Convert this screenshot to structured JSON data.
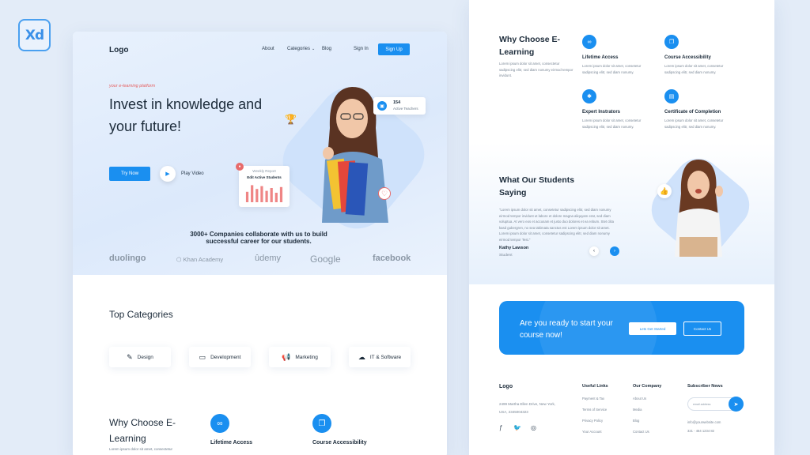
{
  "app": {
    "badge": "Xd"
  },
  "left": {
    "nav": {
      "logo": "Logo",
      "about": "About",
      "categories": "Categories",
      "blog": "Blog",
      "signin": "Sign In",
      "signup": "Sign Up"
    },
    "hero": {
      "tagline": "your e-learning platform",
      "title": "Invest in knowledge and your future!",
      "try_now": "Try Now",
      "play_video": "Play Video",
      "teachers_count": "154",
      "teachers_label": "Active Teachers",
      "report_title": "Weekly Report",
      "report_sub": "Edit Active Students",
      "report_bars": [
        0.55,
        0.9,
        0.7,
        0.85,
        0.6,
        0.75,
        0.5,
        0.8
      ],
      "companies_text": "3000+ Companies collaborate with us to build successful career for our students."
    },
    "brands": [
      "duolingo",
      "Khan Academy",
      "ûdemy",
      "Google",
      "facebook"
    ],
    "top_categories": {
      "title": "Top Categories",
      "items": [
        {
          "label": "Design",
          "icon": "design-icon"
        },
        {
          "label": "Development",
          "icon": "code-icon"
        },
        {
          "label": "Marketing",
          "icon": "megaphone-icon"
        },
        {
          "label": "IT & Software",
          "icon": "cloud-icon"
        }
      ]
    },
    "why": {
      "title": "Why Choose E-Learning",
      "text": "Lorem ipsum dolor sit amet, consectetur",
      "f1": "Lifetime Access",
      "f2": "Course Accessibility"
    }
  },
  "right": {
    "why": {
      "title": "Why Choose E-Learning",
      "desc": "Lorem ipsum dolor sit amet, consectetur sadipscing elitr, sed diam nonumy eirmod tempor invidunt.",
      "features": [
        {
          "title": "Lifetime Access",
          "text": "Lorem ipsum dolor sit amet, consetetur sadipscing elitr, sed diam nonumy."
        },
        {
          "title": "Course Accessibility",
          "text": "Lorem ipsum dolor sit amet, consetetur sadipscing elitr, sed diam nonumy."
        },
        {
          "title": "Expert Instrators",
          "text": "Lorem ipsum dolor sit amet, consetetur sadipscing elitr, sed diam nonumy."
        },
        {
          "title": "Certificate of Completion",
          "text": "Lorem ipsum dolor sit amet, consetetur sadipscing elitr, sed diam nonumy."
        }
      ]
    },
    "students": {
      "title": "What Our Students Saying",
      "quote": "\"Lorem ipsum dolor sit amet, consetetur sadipscing elitr, sed diam nonumy eirmod tempor invidunt ut labore et dolore magna aliquyam erat, sed diam voluptua. At vero eos et accusam et justo duo dolores et ea rebum. Stet clita kasd gubergren, no sea takimata sanctus est Lorem ipsum dolor sit amet. Lorem ipsum dolor sit amet, consetetur sadipscing elitr, sed diam nonumy eirmod tempor Test.\"",
      "name": "Kathy Lawson",
      "role": "Student"
    },
    "cta": {
      "text": "Are you ready to start your course now!",
      "btn1": "Lets Get Started",
      "btn2": "Contact Us"
    },
    "footer": {
      "logo": "Logo",
      "address": "2499 Martha Ellen Drive, New York, USA, 2345004323",
      "useful_title": "Useful Links",
      "useful": [
        "Payment & Tax",
        "Terms of Service",
        "Privacy Policy",
        "Your Account"
      ],
      "company_title": "Our Company",
      "company": [
        "About Us",
        "Media",
        "Blog",
        "Contact Us"
      ],
      "subscribe_title": "Subscriber News",
      "email_placeholder": "email address",
      "contact_email": "info@yourwebsite.com",
      "contact_phone": "321 - 464 1234 82"
    }
  }
}
